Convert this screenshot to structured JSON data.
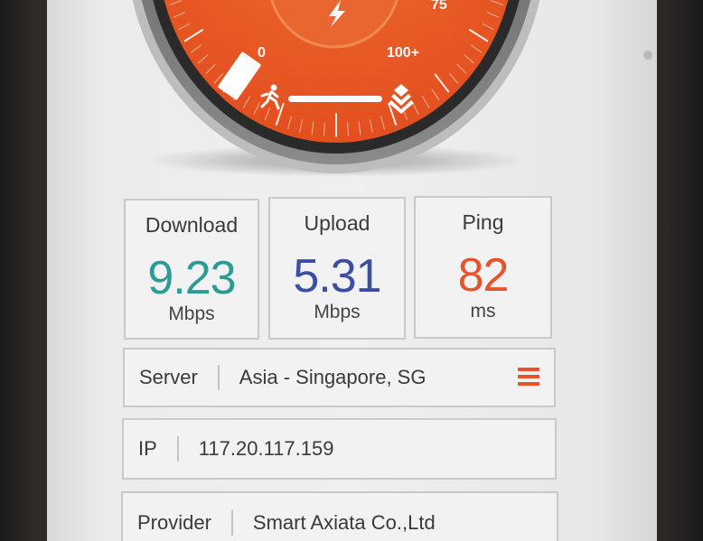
{
  "gauge": {
    "tick_zero": "0",
    "tick_75": "75",
    "tick_100": "100+",
    "accent_color": "#e8532b",
    "icons": [
      "bolt-icon",
      "runner-icon",
      "stack-icon"
    ]
  },
  "results": {
    "download": {
      "title": "Download",
      "value": "9.23",
      "unit": "Mbps",
      "color": "#2a9c94"
    },
    "upload": {
      "title": "Upload",
      "value": "5.31",
      "unit": "Mbps",
      "color": "#3a4fa3"
    },
    "ping": {
      "title": "Ping",
      "value": "82",
      "unit": "ms",
      "color": "#e8532b"
    }
  },
  "server": {
    "label": "Server",
    "value": "Asia - Singapore, SG"
  },
  "ip": {
    "label": "IP",
    "value": "117.20.117.159"
  },
  "provider": {
    "label": "Provider",
    "value": "Smart Axiata Co.,Ltd"
  }
}
